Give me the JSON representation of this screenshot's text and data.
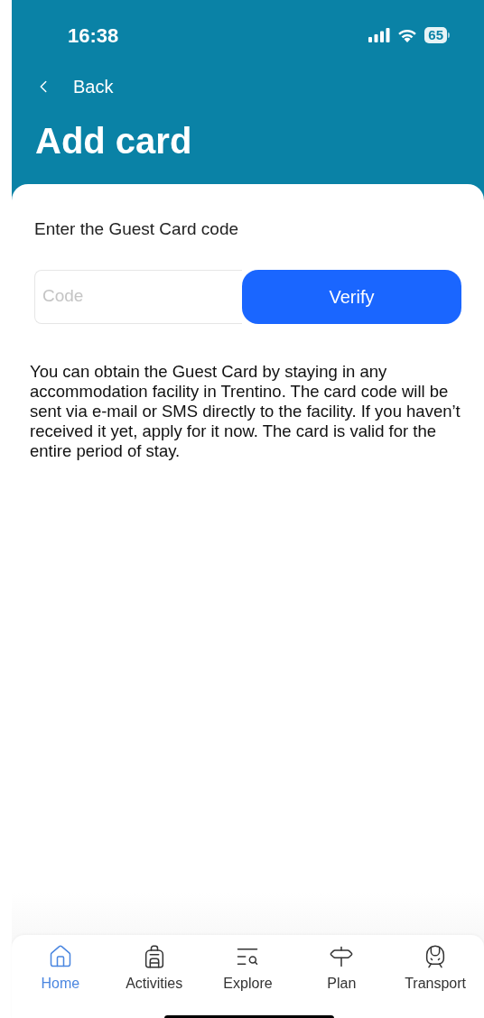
{
  "status_bar": {
    "time": "16:38",
    "battery": "65"
  },
  "header": {
    "back": "Back",
    "title": "Add card"
  },
  "form": {
    "label": "Enter the Guest Card code",
    "code_field": {
      "placeholder": "Code"
    },
    "verify_button": "Verify"
  },
  "info": "You can obtain the Guest Card by staying in any accommodation facility in Trentino. The card code will be sent via e-mail or SMS directly to the facility. If you haven’t received it yet, apply for it now. The card is valid for the entire period of stay.",
  "nav": [
    {
      "kind": "home",
      "label": "Home",
      "selected": true
    },
    {
      "kind": "activities",
      "label": "Activities",
      "selected": false
    },
    {
      "kind": "explore",
      "label": "Explore",
      "selected": false
    },
    {
      "kind": "plan",
      "label": "Plan",
      "selected": false
    },
    {
      "kind": "transport",
      "label": "Transport",
      "selected": false
    }
  ]
}
